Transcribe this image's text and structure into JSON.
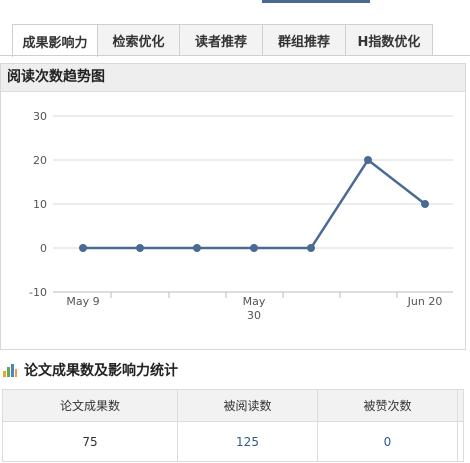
{
  "tabs": [
    {
      "label": "成果影响力",
      "active": true
    },
    {
      "label": "检索优化",
      "active": false
    },
    {
      "label": "读者推荐",
      "active": false
    },
    {
      "label": "群组推荐",
      "active": false
    },
    {
      "label": "H指数优化",
      "active": false
    }
  ],
  "trend_panel": {
    "title": "阅读次数趋势图"
  },
  "chart_data": {
    "type": "line",
    "x": [
      "May 9",
      "",
      "",
      "May 30",
      "",
      "",
      "Jun 20"
    ],
    "x_tick_labels": [
      "May 9",
      "May 30",
      "Jun 20"
    ],
    "values": [
      0,
      0,
      0,
      0,
      0,
      20,
      10
    ],
    "ylim": [
      -10,
      30
    ],
    "yticks": [
      -10,
      0,
      10,
      20,
      30
    ],
    "grid": true,
    "colors": {
      "line": "#4a6a94",
      "grid": "#d9d9d9"
    }
  },
  "stats": {
    "title": "论文成果数及影响力统计",
    "icon": "bar-chart-icon",
    "headers": [
      "论文成果数",
      "被阅读数",
      "被赞次数"
    ],
    "values": [
      "75",
      "125",
      "0"
    ]
  }
}
